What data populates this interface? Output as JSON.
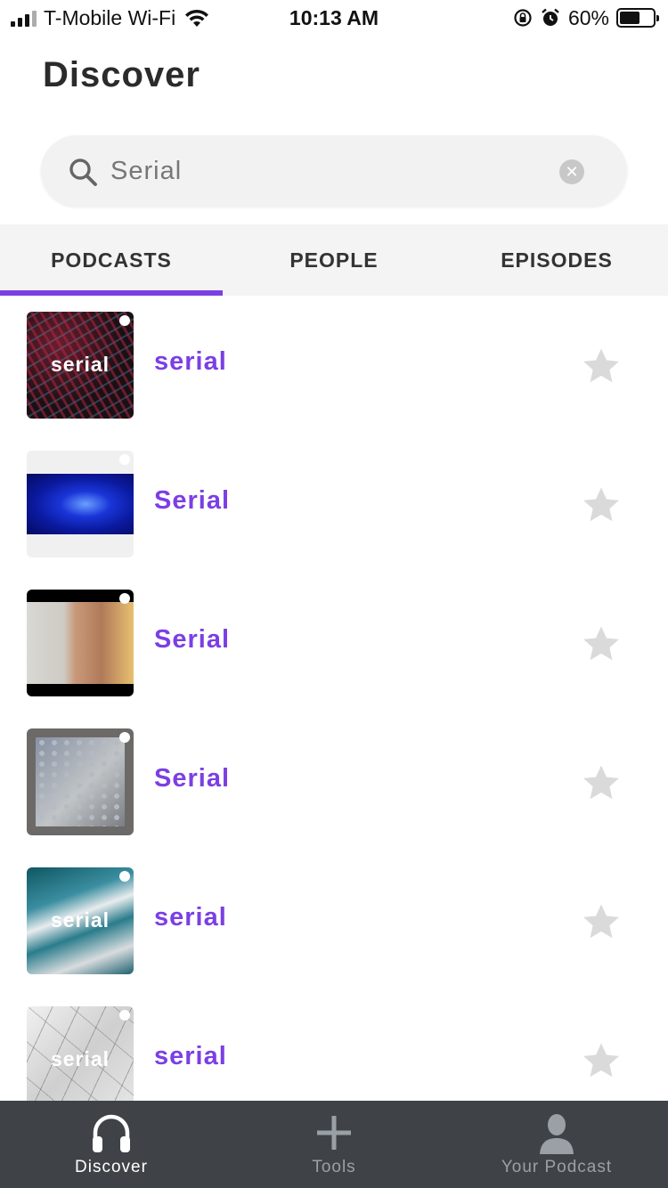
{
  "status_bar": {
    "carrier": "T-Mobile Wi-Fi",
    "time": "10:13 AM",
    "battery": "60%",
    "battery_level": 0.6,
    "icons": [
      "signal-icon",
      "wifi-icon",
      "rotation-lock-icon",
      "alarm-icon",
      "battery-icon"
    ]
  },
  "header": {
    "title": "Discover"
  },
  "search": {
    "value": "Serial",
    "placeholder": ""
  },
  "tabs": [
    {
      "label": "PODCASTS",
      "active": true
    },
    {
      "label": "PEOPLE",
      "active": false
    },
    {
      "label": "EPISODES",
      "active": false
    }
  ],
  "results": [
    {
      "title": "serial",
      "artwork_text": "serial"
    },
    {
      "title": "Serial",
      "artwork_text": ""
    },
    {
      "title": "Serial",
      "artwork_text": ""
    },
    {
      "title": "Serial",
      "artwork_text": ""
    },
    {
      "title": "serial",
      "artwork_text": "serial"
    },
    {
      "title": "serial",
      "artwork_text": "serial"
    }
  ],
  "tab_bar": [
    {
      "label": "Discover",
      "icon": "headphones-icon",
      "active": true
    },
    {
      "label": "Tools",
      "icon": "plus-icon",
      "active": false
    },
    {
      "label": "Your Podcast",
      "icon": "person-icon",
      "active": false
    }
  ],
  "colors": {
    "accent": "#7b3fe4",
    "tab_bar_bg": "#3f4347",
    "star": "#dadada",
    "tab_strip_bg": "#f4f4f4"
  }
}
